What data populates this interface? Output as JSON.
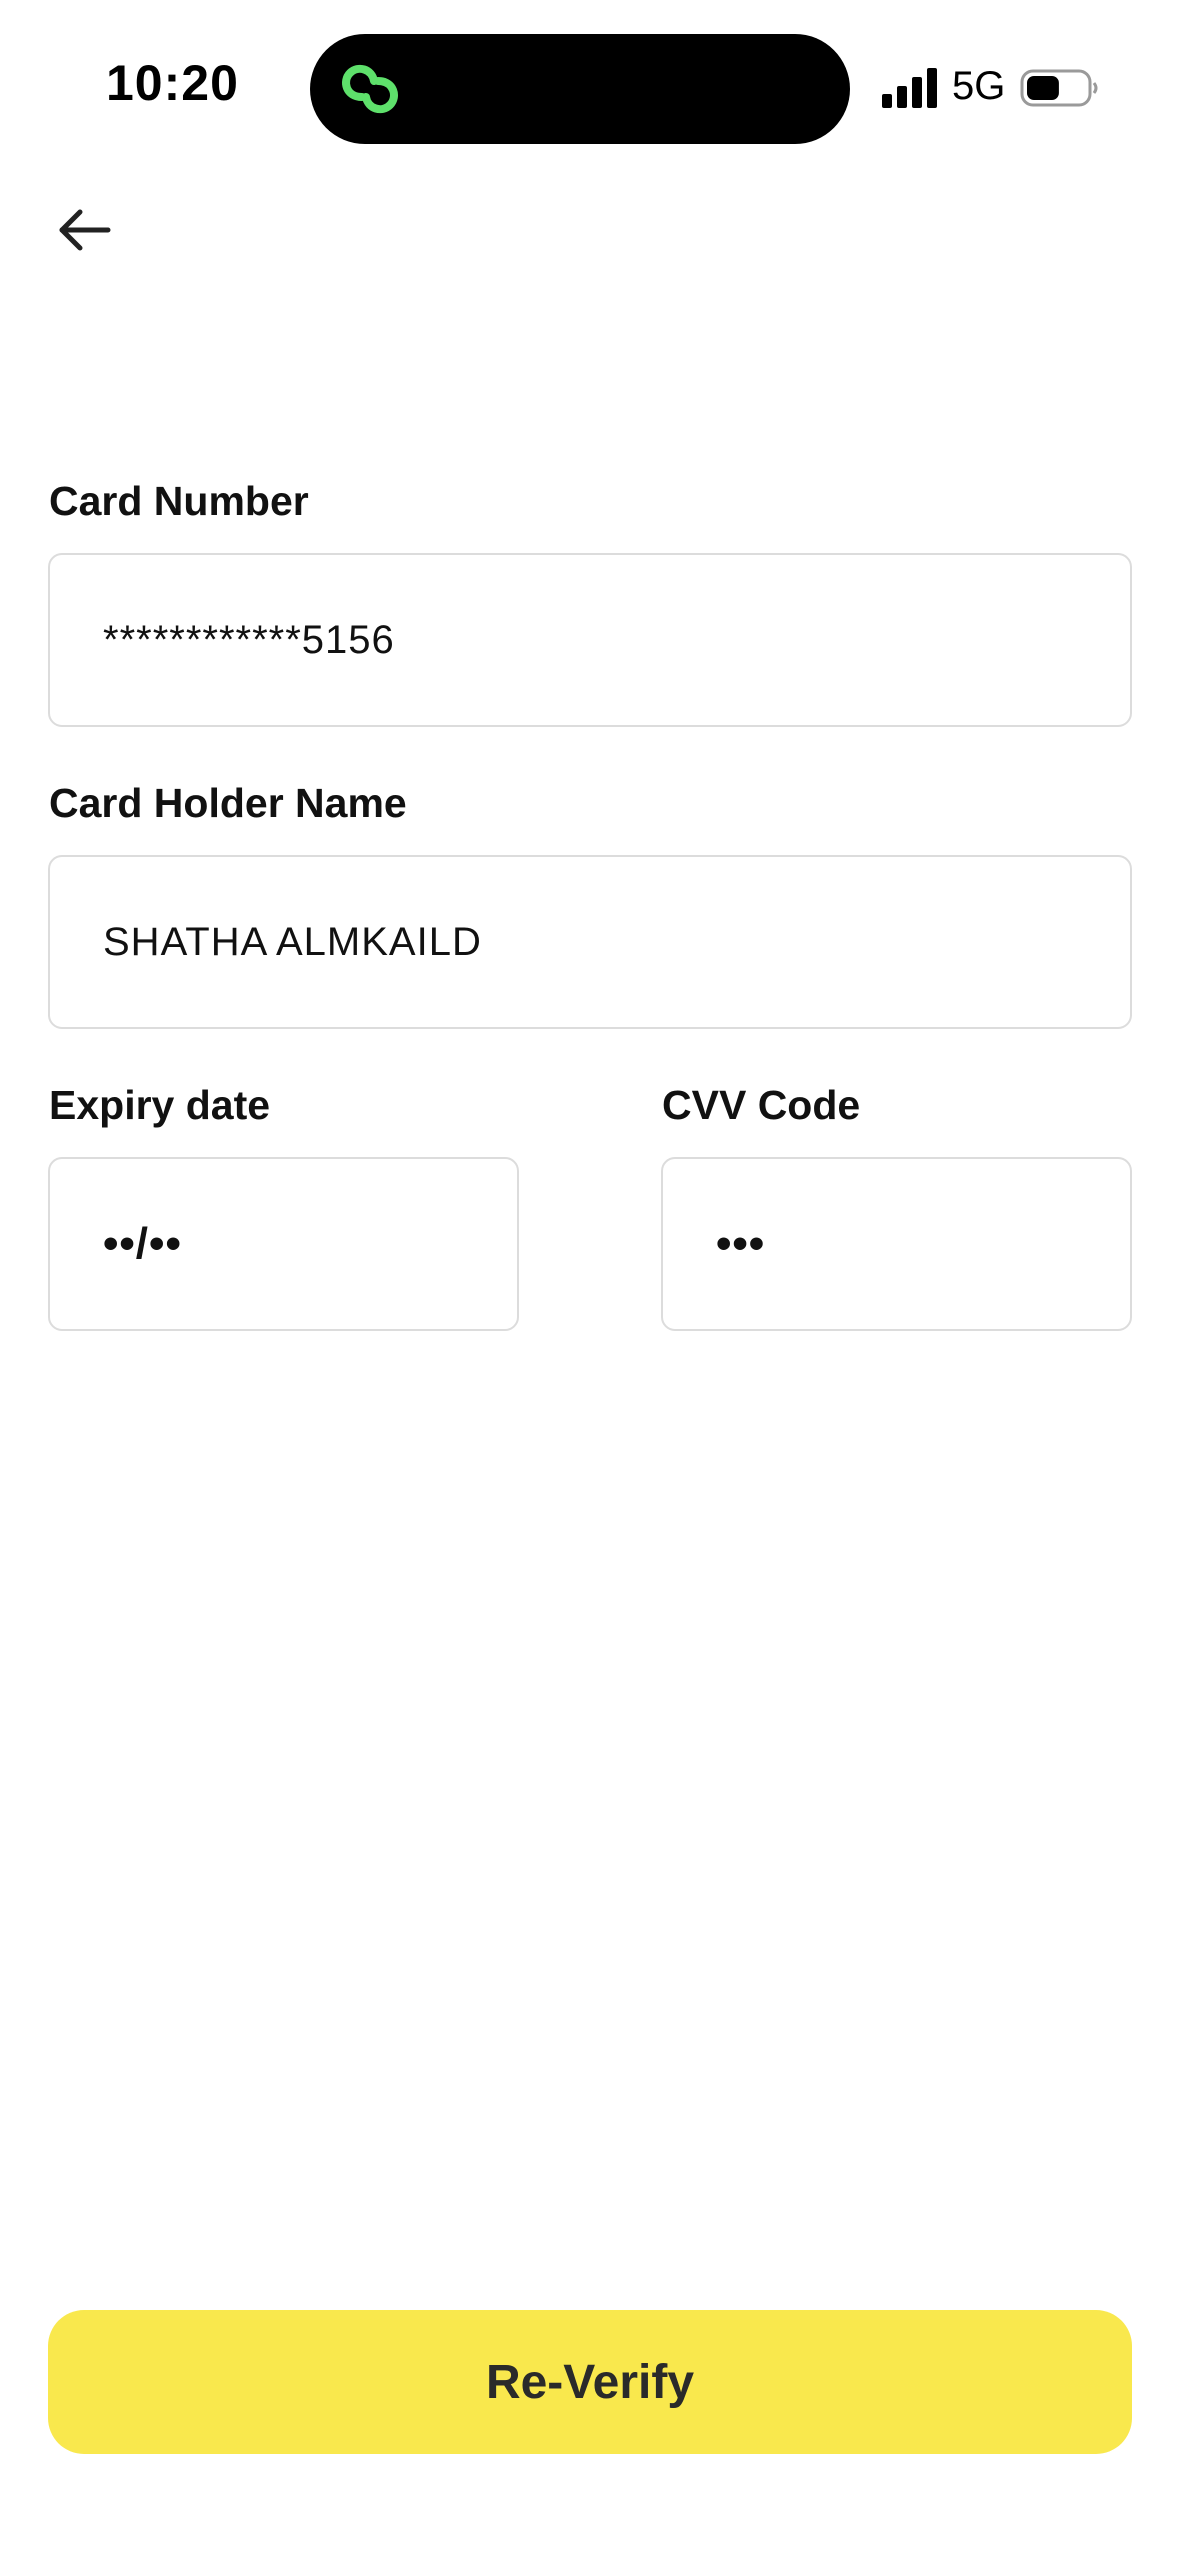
{
  "status_bar": {
    "time": "10:20",
    "network": "5G",
    "island_icon": "link-rings-icon",
    "island_icon_color": "#5ee06b",
    "signal_icon": "cellular-signal-icon",
    "battery_icon": "battery-icon",
    "battery_level": 0.55
  },
  "nav": {
    "back_icon": "arrow-left-icon"
  },
  "form": {
    "card_number": {
      "label": "Card Number",
      "value": "************5156"
    },
    "card_holder": {
      "label": "Card Holder Name",
      "value": "SHATHA ALMKAILD"
    },
    "expiry": {
      "label": "Expiry date",
      "value": "••/••"
    },
    "cvv": {
      "label": "CVV Code",
      "value": "•••"
    }
  },
  "actions": {
    "reverify_label": "Re-Verify",
    "accent_color": "#f9e84d"
  }
}
